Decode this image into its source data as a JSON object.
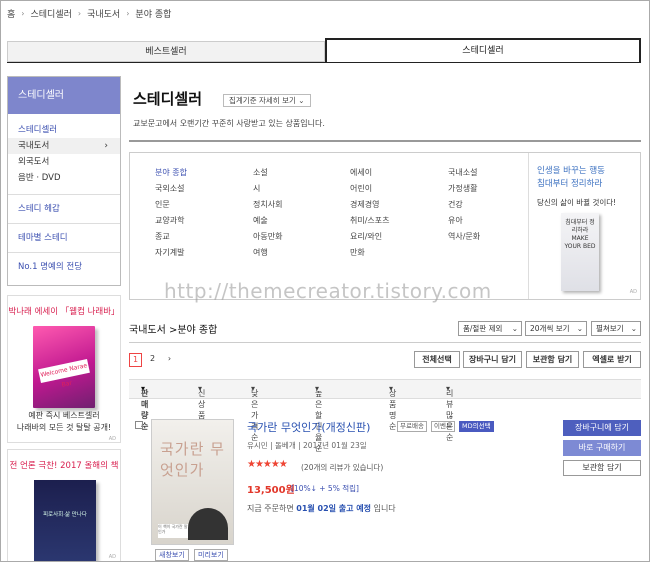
{
  "breadcrumb": [
    "홈",
    "스테디셀러",
    "국내도서",
    "분야 종합"
  ],
  "tabs": [
    {
      "label": "베스트셀러",
      "active": false
    },
    {
      "label": "스테디셀러",
      "active": true
    }
  ],
  "sidebar": {
    "header": "스테디셀러",
    "category_title": "스테디셀러",
    "items": [
      {
        "label": "국내도서",
        "selected": true
      },
      {
        "label": "외국도서",
        "selected": false
      },
      {
        "label": "음반 · DVD",
        "selected": false
      }
    ],
    "links": [
      "스테디 헤갑",
      "테마별 스테디",
      "No.1 명예의 전당"
    ]
  },
  "promo1": {
    "title": "박나래 에세이 「웰컴 나래바」",
    "line1": "예판 즉시 베스트셀러",
    "line2": "나래바의 모든 것 탈탈 공개!",
    "book_text": "Welcome Narae Bar",
    "ad": "AD"
  },
  "promo2": {
    "title": "전 언론 극찬! 2017 올해의 책",
    "book_text": "피로사회·삶 만나다",
    "ad": "AD"
  },
  "main": {
    "title": "스테디셀러",
    "sort_button": "집계기준 자세히 보기",
    "description": "교보문고에서 오랜기간 꾸준히 사랑받고 있는 상품입니다."
  },
  "categories": [
    "분야 종합",
    "소설",
    "에세이",
    "국내소설",
    "국외소설",
    "시",
    "어린이",
    "가정생활",
    "인문",
    "정치사회",
    "경제경영",
    "건강",
    "교양과학",
    "예술",
    "취미/스포츠",
    "유아",
    "종교",
    "아동만화",
    "요리/와인",
    "역사/문화",
    "자기계발",
    "여행",
    "만화",
    ""
  ],
  "category_panel": {
    "title1": "인생을 바꾸는 행동",
    "title2": "침대부터 정리하라",
    "subtitle": "당신의 삶이 바뀔 것이다!",
    "book_text": "침대부터 정리하라 MAKE YOUR BED",
    "ad": "AD"
  },
  "watermark": "http://themecreator.tistory.com",
  "section": {
    "title": "국내도서 >분야 종합",
    "selects": [
      "품/절판 제외",
      "20개씩 보기",
      "펼쳐보기"
    ]
  },
  "pager": {
    "pages": [
      "1",
      "2"
    ],
    "next": "›"
  },
  "list_buttons": [
    "전체선택",
    "장바구니 담기",
    "보관함 담기",
    "엑셀로 받기"
  ],
  "sort_options": [
    "판매량순",
    "신상품순",
    "낮은가격순",
    "높은 할인율순",
    "상품명순",
    "리뷰많은 순"
  ],
  "book": {
    "title": "국가란 무엇인가(개정신판)",
    "tags": [
      "무료배송",
      "이벤트",
      "MD의선택"
    ],
    "author": "유시민",
    "publisher": "돌베개",
    "date": "2017년 01월 23일",
    "stars": "★★★★★",
    "reviews": "(20개의 리뷰가 있습니다)",
    "price": "13,500원",
    "points": "[10%↓ + 5% 적립]",
    "ship_prefix": "지금 주문하면",
    "ship_date": "01월 02일 출고 예정",
    "ship_suffix": "입니다",
    "cover_text": "국가란 무엇인가",
    "cover_note": "이 책이 국가란 말인가",
    "mini_buttons": [
      "새창보기",
      "미리보기"
    ]
  },
  "book_actions": [
    "장바구니에 담기",
    "바로 구매하기",
    "보관함 담기"
  ]
}
